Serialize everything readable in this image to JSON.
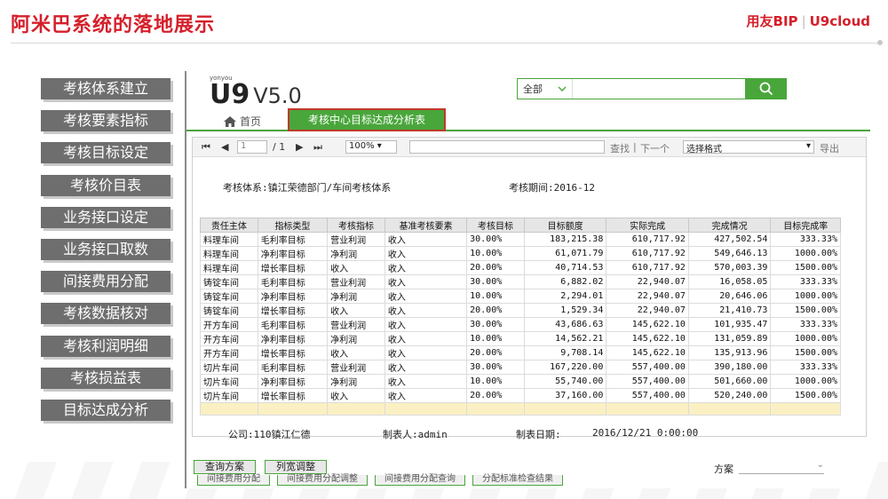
{
  "slide": {
    "title": "阿米巴系统的落地展示",
    "logo_left": "用友BIP",
    "logo_right": "U9cloud"
  },
  "nav": [
    "考核体系建立",
    "考核要素指标",
    "考核目标设定",
    "考核价目表",
    "业务接口设定",
    "业务接口取数",
    "间接费用分配",
    "考核数据核对",
    "考核利润明细",
    "考核损益表",
    "目标达成分析"
  ],
  "app": {
    "brand_small": "yonyou",
    "brand_main": "U9",
    "version": "V5.0",
    "search_scope": "全部",
    "tab_home": "首页",
    "tab_active": "考核中心目标达成分析表"
  },
  "toolbar": {
    "page_current": "1",
    "page_total": "/ 1",
    "zoom": "100%",
    "find": "查找",
    "next": "下一个",
    "format": "选择格式",
    "export": "导出"
  },
  "report": {
    "system_label": "考核体系:镇江荣德部门/车间考核体系",
    "period_label": "考核期间:2016-12",
    "columns": [
      "责任主体",
      "指标类型",
      "考核指标",
      "基准考核要素",
      "考核目标",
      "目标额度",
      "实际完成",
      "完成情况",
      "目标完成率"
    ],
    "rows": [
      [
        "料理车间",
        "毛利率目标",
        "营业利润",
        "收入",
        "30.00%",
        "183,215.38",
        "610,717.92",
        "427,502.54",
        "333.33%"
      ],
      [
        "料理车间",
        "净利率目标",
        "净利润",
        "收入",
        "10.00%",
        "61,071.79",
        "610,717.92",
        "549,646.13",
        "1000.00%"
      ],
      [
        "料理车间",
        "增长率目标",
        "收入",
        "收入",
        "20.00%",
        "40,714.53",
        "610,717.92",
        "570,003.39",
        "1500.00%"
      ],
      [
        "铸锭车间",
        "毛利率目标",
        "营业利润",
        "收入",
        "30.00%",
        "6,882.02",
        "22,940.07",
        "16,058.05",
        "333.33%"
      ],
      [
        "铸锭车间",
        "净利率目标",
        "净利润",
        "收入",
        "10.00%",
        "2,294.01",
        "22,940.07",
        "20,646.06",
        "1000.00%"
      ],
      [
        "铸锭车间",
        "增长率目标",
        "收入",
        "收入",
        "20.00%",
        "1,529.34",
        "22,940.07",
        "21,410.73",
        "1500.00%"
      ],
      [
        "开方车间",
        "毛利率目标",
        "营业利润",
        "收入",
        "30.00%",
        "43,686.63",
        "145,622.10",
        "101,935.47",
        "333.33%"
      ],
      [
        "开方车间",
        "净利率目标",
        "净利润",
        "收入",
        "10.00%",
        "14,562.21",
        "145,622.10",
        "131,059.89",
        "1000.00%"
      ],
      [
        "开方车间",
        "增长率目标",
        "收入",
        "收入",
        "20.00%",
        "9,708.14",
        "145,622.10",
        "135,913.96",
        "1500.00%"
      ],
      [
        "切片车间",
        "毛利率目标",
        "营业利润",
        "收入",
        "30.00%",
        "167,220.00",
        "557,400.00",
        "390,180.00",
        "333.33%"
      ],
      [
        "切片车间",
        "净利率目标",
        "净利润",
        "收入",
        "10.00%",
        "55,740.00",
        "557,400.00",
        "501,660.00",
        "1000.00%"
      ],
      [
        "切片车间",
        "增长率目标",
        "收入",
        "收入",
        "20.00%",
        "37,160.00",
        "557,400.00",
        "520,240.00",
        "1500.00%"
      ]
    ],
    "company_label": "公司:110镇江仁德",
    "maker_label": "制表人:admin",
    "date_label": "制表日期:",
    "date_value": "2016/12/21 0:00:00"
  },
  "buttons": {
    "query": "查询方案",
    "column_adjust": "列宽调整",
    "scheme": "方案"
  },
  "ghost_buttons": [
    "间接费用分配",
    "间接费用分配调整",
    "间接费用分配查询",
    "分配标准检查结果"
  ],
  "colors": {
    "accent_red": "#d5202b",
    "green": "#49a63b",
    "nav_gray": "#6e6e6e",
    "empty_row": "#fbf0c3"
  }
}
